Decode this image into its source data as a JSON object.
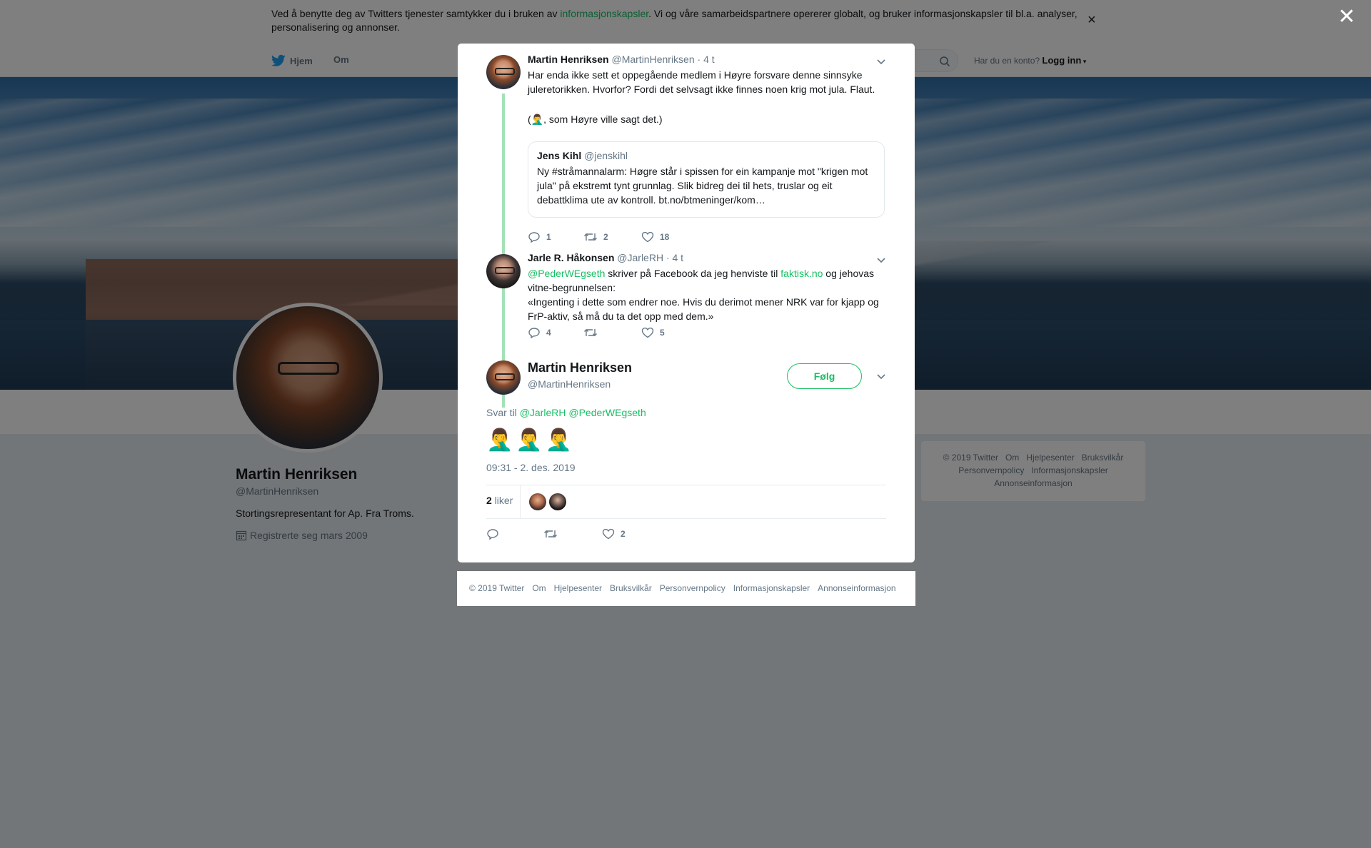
{
  "cookie_banner": {
    "text_before": "Ved å benytte deg av Twitters tjenester samtykker du i bruken av ",
    "link": "informasjonskapsler",
    "text_after": ". Vi og våre samarbeidspartnere opererer globalt, og bruker informasjonskapsler til bl.a. analyser, personalisering og annonser.",
    "close_glyph": "×"
  },
  "nav": {
    "home": "Hjem",
    "about": "Om",
    "login_prompt": "Har du en konto?",
    "login": "Logg inn"
  },
  "profile": {
    "name": "Martin Henriksen",
    "handle": "@MartinHenriksen",
    "bio": "Stortingsrepresentant for Ap. Fra Troms.",
    "joined": "Registrerte seg mars 2009"
  },
  "side_footer": {
    "items": [
      "© 2019 Twitter",
      "Om",
      "Hjelpesenter",
      "Bruksvilkår",
      "Personvernpolicy",
      "Informasjonskapsler",
      "Annonseinformasjon"
    ]
  },
  "overlay_close_glyph": "✕",
  "thread": {
    "tweet1": {
      "name": "Martin Henriksen",
      "handle": "@MartinHenriksen",
      "time": "· 4 t",
      "text_line1": "Har enda ikke sett et oppegående medlem i Høyre forsvare denne sinnsyke juleretorikken. Hvorfor? Fordi det selvsagt ikke finnes noen krig mot jula. Flaut.",
      "text_line2": "(🤦‍♂️, som Høyre ville sagt det.)",
      "quote": {
        "name": "Jens Kihl",
        "handle": "@jenskihl",
        "text": "Ny #stråmannalarm: Høgre står i spissen for ein kampanje mot \"krigen mot jula\" på ekstremt tynt grunnlag. Slik bidreg dei til hets, truslar og eit debattklima ute av kontroll.  bt.no/btmeninger/kom…"
      },
      "replies": "1",
      "retweets": "2",
      "likes": "18"
    },
    "tweet2": {
      "name": "Jarle R. Håkonsen",
      "handle": "@JarleRH",
      "time": "· 4 t",
      "mention": "@PederWEgseth",
      "text_mid": " skriver på Facebook da jeg henviste til ",
      "link": "faktisk.no",
      "text_end": " og jehovas vitne-begrunnelsen:",
      "quote_text": "«Ingenting i dette som endrer noe. Hvis du derimot mener NRK var for kjapp og FrP-aktiv, så må du ta det opp med dem.»",
      "replies": "4",
      "retweets": "",
      "likes": "5"
    },
    "main": {
      "name": "Martin Henriksen",
      "handle": "@MartinHenriksen",
      "follow": "Følg",
      "reply_prefix": "Svar til",
      "reply_to_1": "@JarleRH",
      "reply_to_2": "@PederWEgseth",
      "emojis": "🤦‍♂️🤦‍♂️🤦‍♂️",
      "timestamp": "09:31 - 2. des. 2019",
      "likes_count": "2",
      "likes_label": "liker",
      "like_action_count": "2"
    }
  },
  "modal_footer": {
    "items": [
      "© 2019 Twitter",
      "Om",
      "Hjelpesenter",
      "Bruksvilkår",
      "Personvernpolicy",
      "Informasjonskapsler",
      "Annonseinformasjon"
    ]
  },
  "colors": {
    "accent": "#17bf63",
    "thread_line": "#a3e1b8",
    "muted": "#657786",
    "twitter_blue": "#1da1f2"
  }
}
